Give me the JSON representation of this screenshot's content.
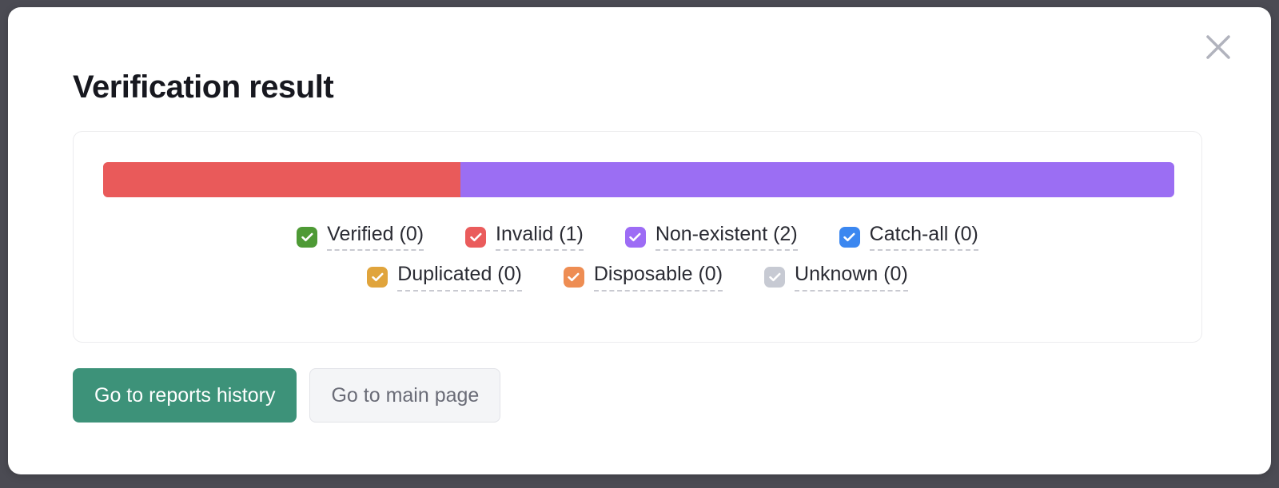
{
  "modal": {
    "title": "Verification result",
    "close_icon": "close-icon"
  },
  "progress": {
    "total": 3,
    "segments": [
      {
        "name": "Invalid",
        "count": 1,
        "percent": 33.33,
        "color": "#e95a5a"
      },
      {
        "name": "Non-existent",
        "count": 2,
        "percent": 66.67,
        "color": "#9b6ef3"
      }
    ]
  },
  "legend": {
    "rows": [
      [
        {
          "label": "Verified (0)",
          "name": "verified",
          "count": 0,
          "color": "#4e9a35",
          "checked": true
        },
        {
          "label": "Invalid (1)",
          "name": "invalid",
          "count": 1,
          "color": "#ea5c5c",
          "checked": true
        },
        {
          "label": "Non-existent (2)",
          "name": "non-existent",
          "count": 2,
          "color": "#9d6cf5",
          "checked": true
        },
        {
          "label": "Catch-all (0)",
          "name": "catch-all",
          "count": 0,
          "color": "#3b87f0",
          "checked": true
        }
      ],
      [
        {
          "label": "Duplicated (0)",
          "name": "duplicated",
          "count": 0,
          "color": "#e0a43c",
          "checked": true
        },
        {
          "label": "Disposable (0)",
          "name": "disposable",
          "count": 0,
          "color": "#ee8d53",
          "checked": true
        },
        {
          "label": "Unknown (0)",
          "name": "unknown",
          "count": 0,
          "color": "#c7cad3",
          "checked": true
        }
      ]
    ]
  },
  "actions": {
    "reports_history_label": "Go to reports history",
    "main_page_label": "Go to main page"
  },
  "colors": {
    "backdrop": "#4b4b53",
    "modal_bg": "#ffffff",
    "primary_button": "#3d9279",
    "secondary_button": "#f4f5f7",
    "panel_border": "#ececee",
    "title_text": "#17181f"
  }
}
